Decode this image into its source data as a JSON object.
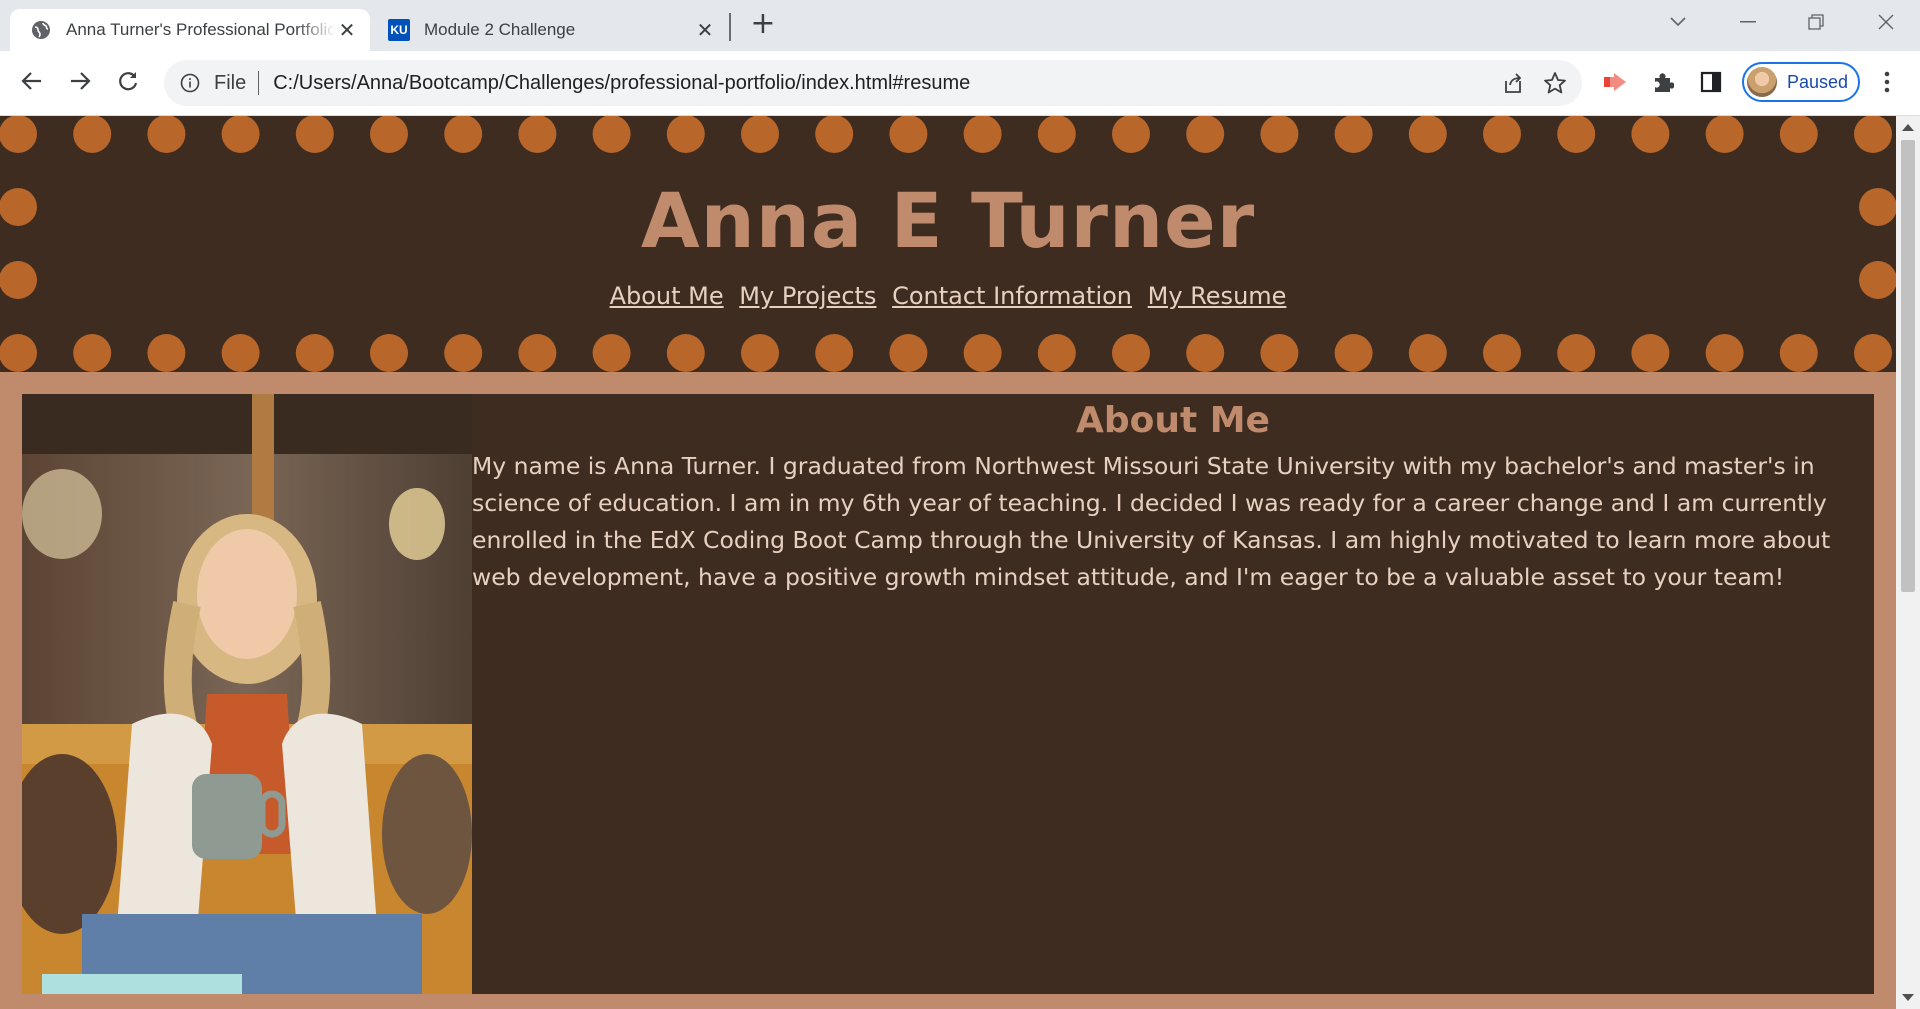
{
  "browser": {
    "tabs": [
      {
        "title": "Anna Turner's Professional Portfolio",
        "favicon": "globe-icon",
        "active": true
      },
      {
        "title": "Module 2 Challenge",
        "favicon": "ku-icon",
        "favicon_text": "KU",
        "active": false
      }
    ],
    "omnibox": {
      "scheme_label": "File",
      "url": "C:/Users/Anna/Bootcamp/Challenges/professional-portfolio/index.html#resume"
    },
    "profile_label": "Paused",
    "colors": {
      "accent": "#1a73e8",
      "tabbar": "#e4e7ec"
    }
  },
  "page": {
    "header": {
      "title": "Anna E Turner",
      "nav": [
        "About Me",
        "My Projects",
        "Contact Information",
        "My Resume"
      ]
    },
    "about": {
      "heading": "About Me",
      "text": "My name is Anna Turner. I graduated from Northwest Missouri State University with my bachelor's and master's in science of education. I am in my 6th year of teaching. I decided I was ready for a career change and I am currently enrolled in the EdX Coding Boot Camp through the University of Kansas. I am highly motivated to learn more about web development, have a positive growth mindset attitude, and I'm eager to be a valuable asset to your team!",
      "photo": "portrait-photo"
    },
    "colors": {
      "dark": "#3e2c21",
      "accent": "#c08b6c",
      "dots": "#b8662a",
      "text": "#e7d0c0"
    }
  }
}
